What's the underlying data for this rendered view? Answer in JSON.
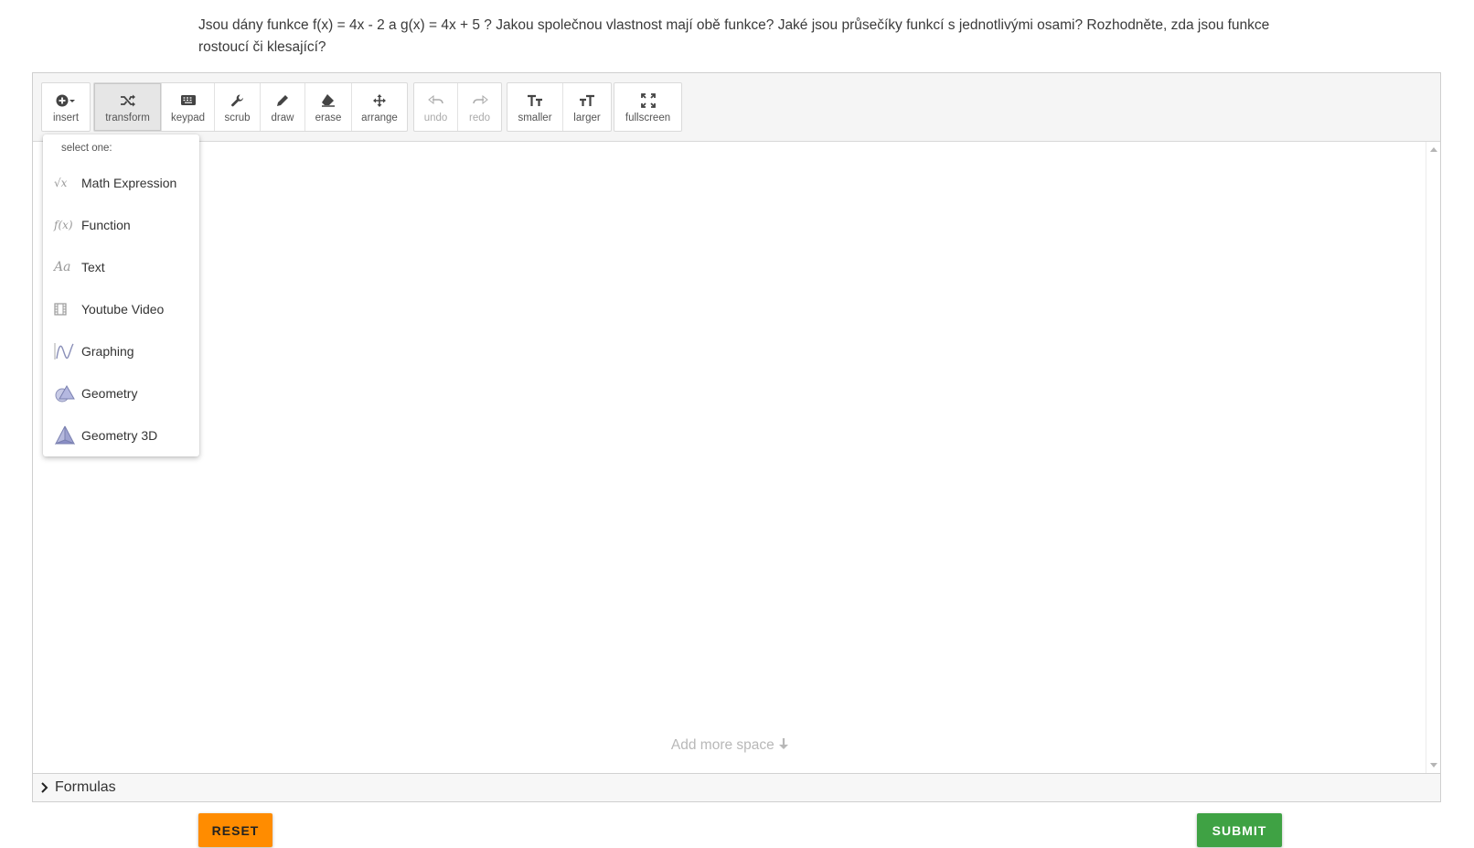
{
  "question": {
    "text": "Jsou dány funkce  f(x) = 4x - 2 a g(x) = 4x + 5 ? Jakou společnou vlastnost mají obě funkce? Jaké jsou průsečíky funkcí s jednotlivými osami? Rozhodněte, zda jsou funkce rostoucí či klesající?"
  },
  "toolbar": {
    "insert": "insert",
    "transform": "transform",
    "keypad": "keypad",
    "scrub": "scrub",
    "draw": "draw",
    "erase": "erase",
    "arrange": "arrange",
    "undo": "undo",
    "redo": "redo",
    "smaller": "smaller",
    "larger": "larger",
    "fullscreen": "fullscreen"
  },
  "insert_menu": {
    "header": "select one:",
    "items": [
      {
        "label": "Math Expression",
        "icon": "sqrt-icon",
        "glyph": "√x"
      },
      {
        "label": "Function",
        "icon": "function-icon",
        "glyph": "f(x)"
      },
      {
        "label": "Text",
        "icon": "text-icon",
        "glyph": "Aa"
      },
      {
        "label": "Youtube Video",
        "icon": "film-icon"
      },
      {
        "label": "Graphing",
        "icon": "graph-icon"
      },
      {
        "label": "Geometry",
        "icon": "geometry-icon"
      },
      {
        "label": "Geometry 3D",
        "icon": "pyramid-icon"
      }
    ]
  },
  "canvas": {
    "add_more_space": "Add more space"
  },
  "formulas": {
    "label": "Formulas"
  },
  "actions": {
    "reset": "RESET",
    "submit": "SUBMIT"
  },
  "colors": {
    "reset": "#ff8c00",
    "submit": "#3fa244"
  }
}
